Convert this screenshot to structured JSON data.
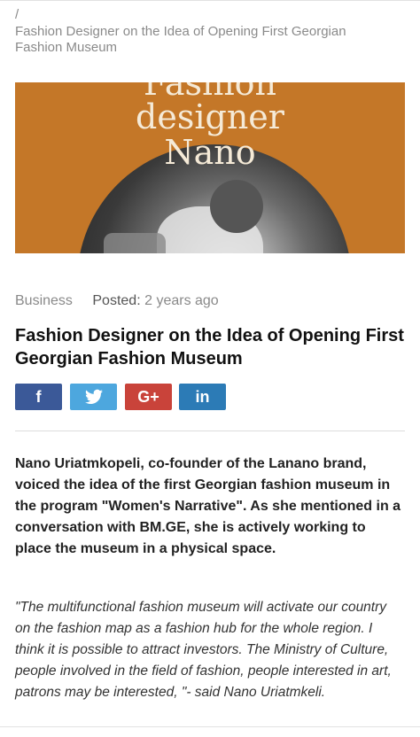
{
  "breadcrumb": {
    "separator": "/",
    "title": "Fashion Designer on the Idea of Opening First Georgian Fashion Museum"
  },
  "hero": {
    "line1": "Fashion",
    "line2": "designer",
    "line3": "Nano",
    "background_color": "#c47728"
  },
  "meta": {
    "category": "Business",
    "posted_label": "Posted:",
    "posted_value": "2 years ago"
  },
  "article": {
    "title": "Fashion Designer on the Idea of Opening First Georgian Fashion Museum",
    "lead": "Nano Uriatmkopeli, co-founder of the Lanano brand, voiced the idea of the first Georgian fashion museum in the program \"Women's Narrative\". As she mentioned in a conversation with BM.GE, she is actively working to place the museum in a physical space.",
    "quote": "\"The multifunctional fashion museum will activate our country on the fashion map as a fashion hub for the whole region. I think it is possible to attract investors. The Ministry of Culture, people involved in the field of fashion, people interested in art, patrons may be interested, \"- said Nano Uriatmkeli."
  },
  "share": {
    "facebook": {
      "label": "f",
      "icon": "facebook-icon",
      "color": "#3b5998"
    },
    "twitter": {
      "icon": "twitter-icon",
      "color": "#4da7de"
    },
    "googleplus": {
      "label": "G+",
      "icon": "google-plus-icon",
      "color": "#c9433a"
    },
    "linkedin": {
      "label": "in",
      "icon": "linkedin-icon",
      "color": "#2c7bb6"
    }
  }
}
